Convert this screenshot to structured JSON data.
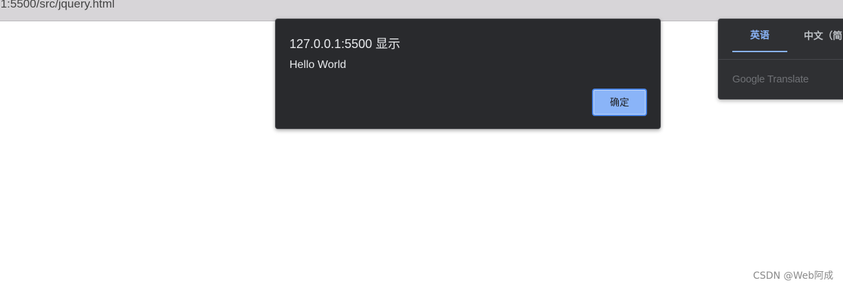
{
  "browser": {
    "url": ".1:5500/src/jquery.html"
  },
  "alert": {
    "origin": "127.0.0.1:5500 显示",
    "message": "Hello World",
    "ok_label": "确定"
  },
  "translate": {
    "tabs": [
      {
        "label": "英语",
        "active": true
      },
      {
        "label": "中文（简",
        "active": false
      }
    ],
    "branding": "Google Translate"
  },
  "watermark": "CSDN @Web阿成",
  "colors": {
    "dialog_bg": "#292a2d",
    "accent": "#8ab4f8",
    "button_border": "#4a86e8",
    "address_bar_bg": "#d7d5d8"
  }
}
